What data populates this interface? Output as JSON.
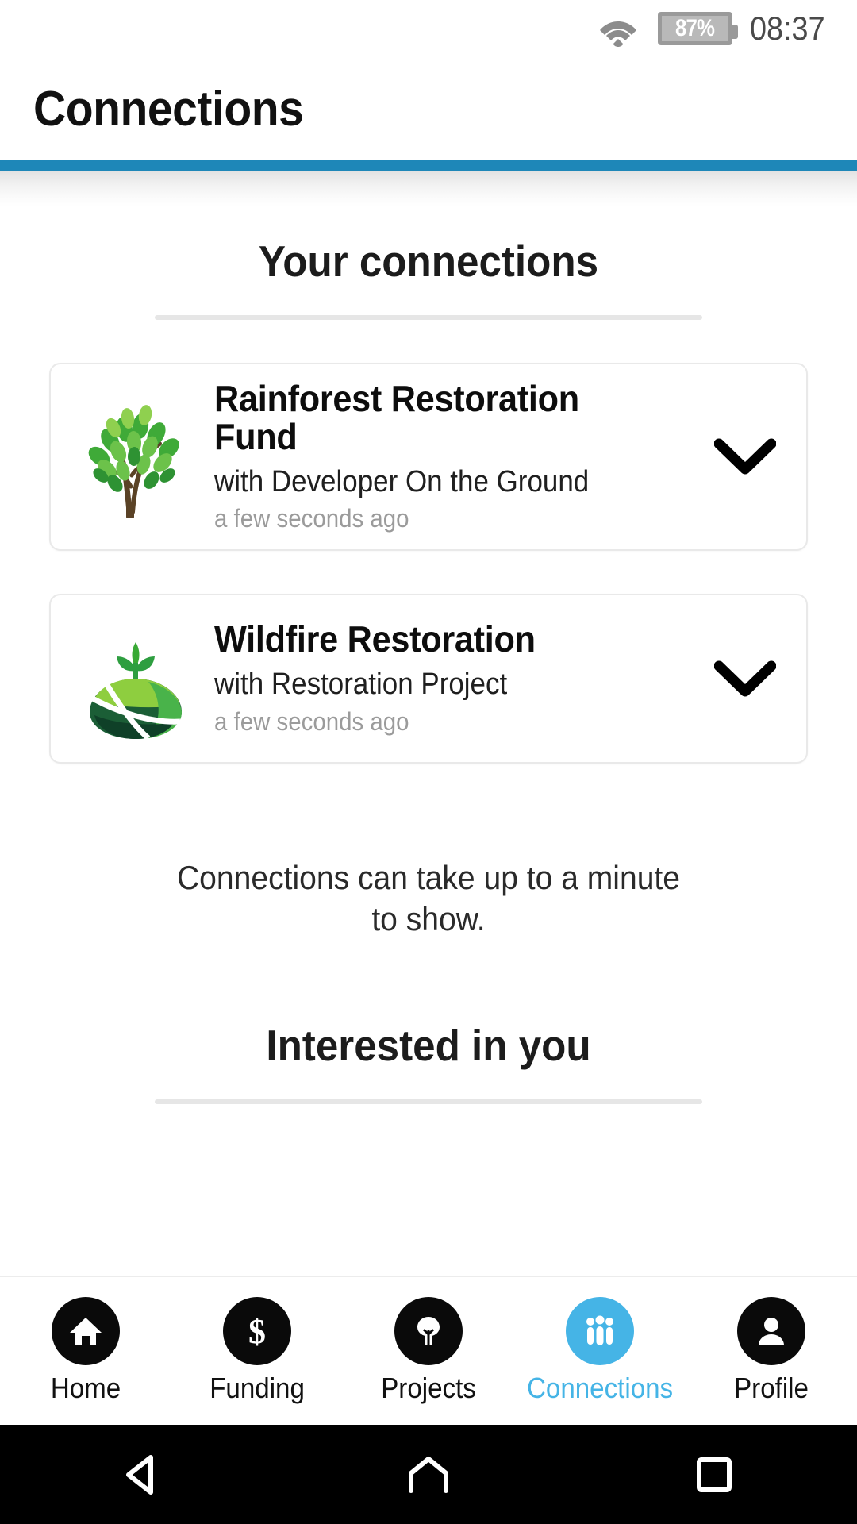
{
  "statusbar": {
    "wifi_icon": "wifi-icon",
    "battery_percent": "87%",
    "battery_icon": "battery-icon",
    "time": "08:37"
  },
  "header": {
    "title": "Connections",
    "accent_color": "#1e87b8"
  },
  "main": {
    "your_connections_heading": "Your connections",
    "connections": [
      {
        "logo": "tree-logo",
        "title": "Rainforest Restoration Fund",
        "subtitle": "with Developer On the Ground",
        "timestamp": "a few seconds ago",
        "expand_icon": "chevron-down-icon"
      },
      {
        "logo": "sprout-field-logo",
        "title": "Wildfire Restoration",
        "subtitle": "with Restoration Project",
        "timestamp": "a few seconds ago",
        "expand_icon": "chevron-down-icon"
      }
    ],
    "note": "Connections can take up to a minute to show.",
    "interested_heading": "Interested in you"
  },
  "tabbar": {
    "active_color": "#45b4e6",
    "items": [
      {
        "label": "Home",
        "icon": "home-icon",
        "active": false
      },
      {
        "label": "Funding",
        "icon": "dollar-icon",
        "active": false
      },
      {
        "label": "Projects",
        "icon": "tree-icon",
        "active": false
      },
      {
        "label": "Connections",
        "icon": "people-icon",
        "active": true
      },
      {
        "label": "Profile",
        "icon": "person-icon",
        "active": false
      }
    ]
  },
  "sysnav": {
    "back": "back-triangle-icon",
    "home": "home-outline-icon",
    "recents": "square-icon"
  }
}
